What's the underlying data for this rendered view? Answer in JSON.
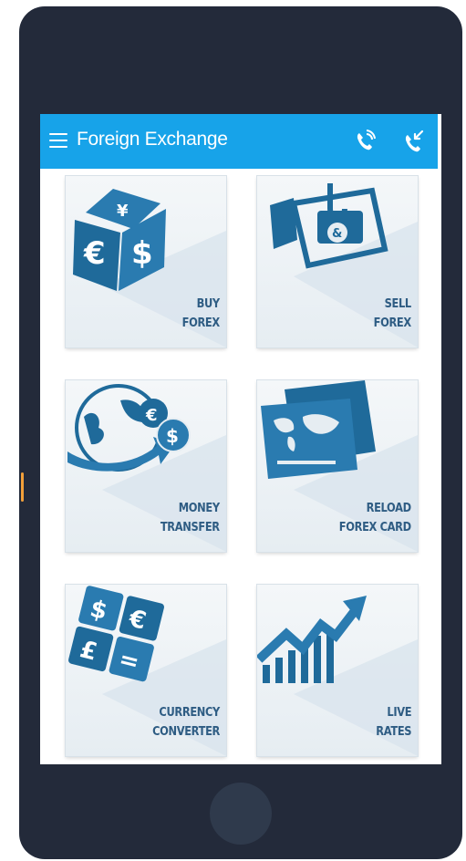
{
  "app": {
    "title": "Foreign Exchange"
  },
  "icons": {
    "menu": "hamburger-menu-icon",
    "call": "phone-call-icon",
    "callback": "phone-callback-icon"
  },
  "colors": {
    "appbar": "#17a3e9",
    "phone_frame": "#232a3a",
    "tile_label": "#2e5c83",
    "tile_icon": "#1f6a9a"
  },
  "tiles": [
    {
      "line1": "BUY",
      "line2": "FOREX",
      "icon": "currency-dice-icon"
    },
    {
      "line1": "SELL",
      "line2": "FOREX",
      "icon": "money-hook-icon"
    },
    {
      "line1": "MONEY",
      "line2": "TRANSFER",
      "icon": "globe-transfer-icon"
    },
    {
      "line1": "RELOAD",
      "line2": "FOREX CARD",
      "icon": "forex-card-icon"
    },
    {
      "line1": "CURRENCY",
      "line2": "CONVERTER",
      "icon": "currency-converter-icon"
    },
    {
      "line1": "LIVE",
      "line2": "RATES",
      "icon": "rising-chart-icon"
    }
  ]
}
